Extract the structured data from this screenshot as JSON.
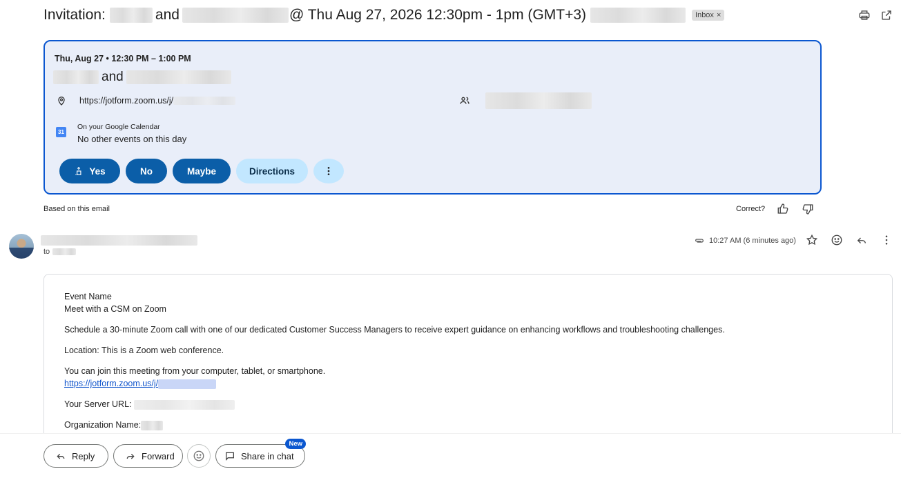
{
  "subject": {
    "prefix": "Invitation:",
    "and": "and",
    "when": "@ Thu Aug 27, 2026 12:30pm - 1pm (GMT+3)",
    "label_chip": "Inbox",
    "label_remove": "×"
  },
  "event_card": {
    "date_time": "Thu, Aug 27 • 12:30 PM – 1:00 PM",
    "title_and": "and",
    "location_link": "https://jotform.zoom.us/j/",
    "calendar_heading": "On your Google Calendar",
    "calendar_status": "No other events on this day",
    "calendar_day": "31",
    "actions": {
      "yes": "Yes",
      "no": "No",
      "maybe": "Maybe",
      "directions": "Directions"
    }
  },
  "feedback": {
    "based_on": "Based on this email",
    "correct": "Correct?"
  },
  "message": {
    "to_prefix": "to",
    "timestamp": "10:27 AM (6 minutes ago)"
  },
  "body": {
    "event_name_label": "Event Name",
    "event_name": "Meet with a CSM on Zoom",
    "description": "Schedule a 30-minute Zoom call with one of our dedicated Customer Success Managers to receive expert guidance on enhancing workflows and troubleshooting challenges.",
    "location": "Location: This is a Zoom web conference.",
    "join_text": "You can join this meeting from your computer, tablet, or smartphone.",
    "join_link": "https://jotform.zoom.us/j/",
    "server_url_label": "Your Server URL:",
    "org_name_label": "Organization Name:"
  },
  "bottom_actions": {
    "reply": "Reply",
    "forward": "Forward",
    "share_in_chat": "Share in chat",
    "new_badge": "New"
  },
  "colors": {
    "accent": "#0b57d0",
    "card_bg": "#e9eef9",
    "dark_pill": "#0b5ea8",
    "light_pill": "#c2e7ff",
    "link": "#1155cc"
  }
}
